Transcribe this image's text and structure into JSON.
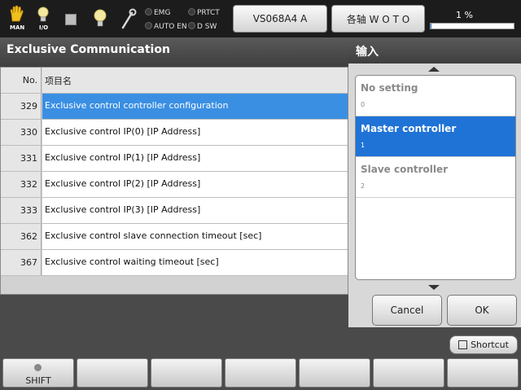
{
  "topbar": {
    "icons": [
      {
        "name": "hand-icon",
        "label": "MAN"
      },
      {
        "name": "bulb-io-icon",
        "label": "I/O"
      },
      {
        "name": "stop-icon"
      },
      {
        "name": "bulb-icon"
      },
      {
        "name": "wrench-icon"
      }
    ],
    "indicators": {
      "emg": "EMG",
      "prtct": "PRTCT",
      "auto_en": "AUTO EN",
      "dsw": "D SW"
    },
    "robot_button": "VS068A4 A",
    "axis_button": "各轴  W O T O",
    "progress_text": "1 %",
    "progress_fraction": 0.01
  },
  "left": {
    "title": "Exclusive Communication",
    "header_no": "No.",
    "header_name": "项目名",
    "rows": [
      {
        "no": "329",
        "name": "Exclusive control controller configuration",
        "selected": true
      },
      {
        "no": "330",
        "name": "Exclusive control IP(0) [IP Address]"
      },
      {
        "no": "331",
        "name": "Exclusive control IP(1) [IP Address]"
      },
      {
        "no": "332",
        "name": "Exclusive control IP(2) [IP Address]"
      },
      {
        "no": "333",
        "name": "Exclusive control IP(3) [IP Address]"
      },
      {
        "no": "362",
        "name": "Exclusive control slave connection timeout [sec]"
      },
      {
        "no": "367",
        "name": "Exclusive control waiting timeout [sec]"
      }
    ]
  },
  "right": {
    "title": "输入",
    "options": [
      {
        "label": "No setting",
        "value": "0"
      },
      {
        "label": "Master controller",
        "value": "1",
        "selected": true
      },
      {
        "label": "Slave controller",
        "value": "2"
      }
    ],
    "cancel": "Cancel",
    "ok": "OK"
  },
  "bottom": {
    "shortcut": "Shortcut",
    "shift": "SHIFT"
  },
  "colors": {
    "accent": "#1f73d6",
    "selected_row": "#3a8fe3"
  }
}
